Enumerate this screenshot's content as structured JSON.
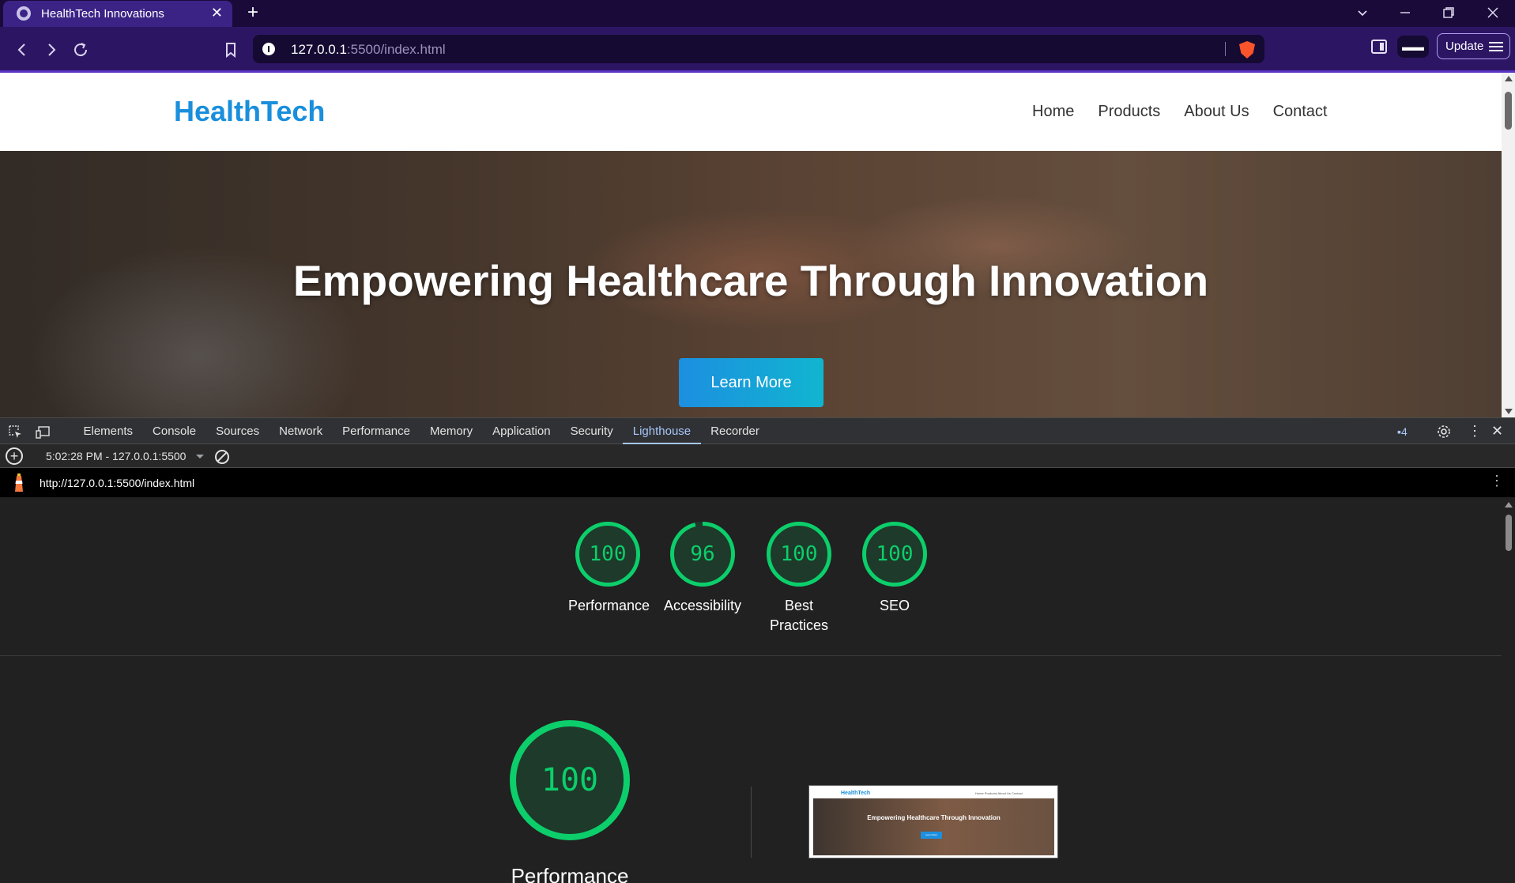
{
  "browser": {
    "tab_title": "HealthTech Innovations",
    "url_host": "127.0.0.1",
    "url_path": ":5500/index.html",
    "update_label": "Update",
    "accent_color": "#3b2386"
  },
  "site": {
    "logo": "HealthTech",
    "nav": [
      "Home",
      "Products",
      "About Us",
      "Contact"
    ],
    "hero_title": "Empowering Healthcare Through Innovation",
    "hero_button": "Learn More",
    "brand_color": "#1a8fdc"
  },
  "devtools": {
    "tabs": [
      "Elements",
      "Console",
      "Sources",
      "Network",
      "Performance",
      "Memory",
      "Application",
      "Security",
      "Lighthouse",
      "Recorder"
    ],
    "active_tab": "Lighthouse",
    "issues_count": "4",
    "run_label": "5:02:28 PM - 127.0.0.1:5500",
    "report_url": "http://127.0.0.1:5500/index.html"
  },
  "lighthouse": {
    "scores": [
      {
        "label": "Performance",
        "value": "100",
        "fraction": 1.0
      },
      {
        "label": "Accessibility",
        "value": "96",
        "fraction": 0.96
      },
      {
        "label": "Best Practices",
        "value": "100",
        "fraction": 1.0
      },
      {
        "label": "SEO",
        "value": "100",
        "fraction": 1.0
      }
    ],
    "main_score": {
      "label": "Performance",
      "value": "100",
      "fraction": 1.0
    },
    "pass_color": "#0cce6b"
  },
  "thumbnail": {
    "logo": "HealthTech",
    "nav": "Home   Products   About Us   Contact",
    "title": "Empowering Healthcare Through Innovation",
    "button": "Learn More"
  }
}
